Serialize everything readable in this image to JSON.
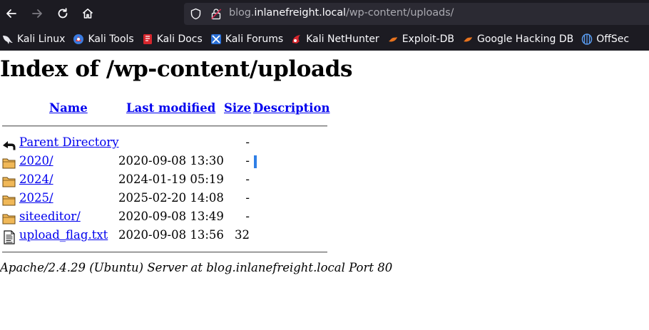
{
  "browser": {
    "url_prefix": "blog.",
    "url_host": "inlanefreight.local",
    "url_path": "/wp-content/uploads/",
    "nav": {
      "back": "back-icon",
      "forward": "forward-icon",
      "reload": "reload-icon",
      "home": "home-icon"
    }
  },
  "bookmarks": [
    {
      "label": "Kali Linux",
      "icon": "kali-dragon-icon"
    },
    {
      "label": "Kali Tools",
      "icon": "kali-tools-icon"
    },
    {
      "label": "Kali Docs",
      "icon": "kali-docs-icon"
    },
    {
      "label": "Kali Forums",
      "icon": "kali-forums-icon"
    },
    {
      "label": "Kali NetHunter",
      "icon": "nethunter-icon"
    },
    {
      "label": "Exploit-DB",
      "icon": "exploit-db-icon"
    },
    {
      "label": "Google Hacking DB",
      "icon": "ghdb-icon"
    },
    {
      "label": "OffSec",
      "icon": "offsec-icon"
    }
  ],
  "page": {
    "title": "Index of /wp-content/uploads",
    "columns": {
      "name": "Name",
      "modified": "Last modified",
      "size": "Size",
      "description": "Description"
    },
    "rows": [
      {
        "name": "Parent Directory",
        "date": "",
        "size": "-",
        "icon": "back-folder-icon"
      },
      {
        "name": "2020/",
        "date": "2020-09-08 13:30",
        "size": "-",
        "icon": "folder-icon"
      },
      {
        "name": "2024/",
        "date": "2024-01-19 05:19",
        "size": "-",
        "icon": "folder-icon"
      },
      {
        "name": "2025/",
        "date": "2025-02-20 14:08",
        "size": "-",
        "icon": "folder-icon"
      },
      {
        "name": "siteeditor/",
        "date": "2020-09-08 13:49",
        "size": "-",
        "icon": "folder-icon"
      },
      {
        "name": "upload_flag.txt",
        "date": "2020-09-08 13:56",
        "size": "32",
        "icon": "text-file-icon"
      }
    ],
    "footer": "Apache/2.4.29 (Ubuntu) Server at blog.inlanefreight.local Port 80"
  },
  "colors": {
    "chrome": "#1c1b22",
    "urlbar": "#2b2a33",
    "link": "#0000ee",
    "accent": "#2f7fe6"
  }
}
